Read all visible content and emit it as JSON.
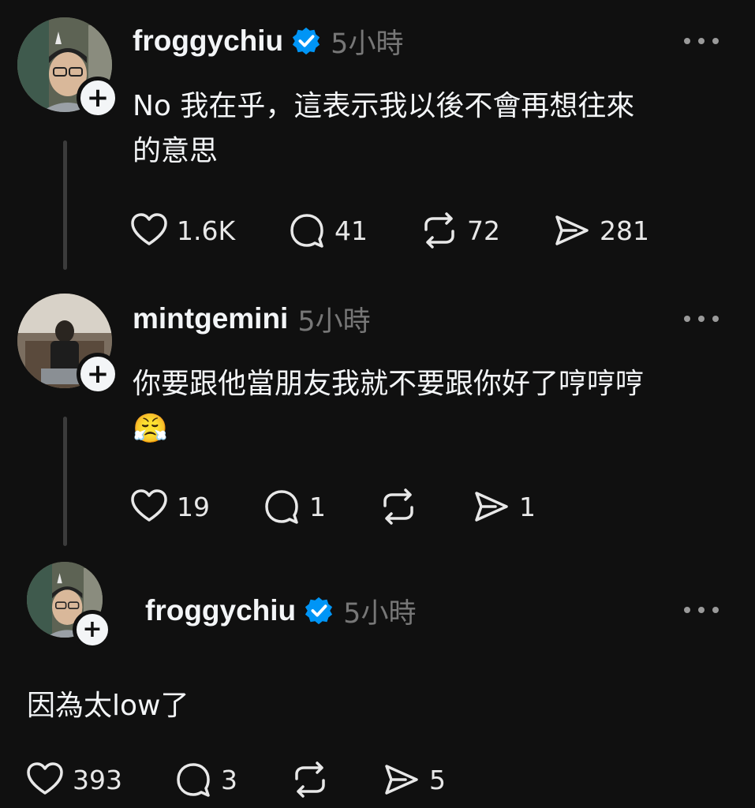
{
  "posts": [
    {
      "username": "froggychiu",
      "verified": true,
      "time": "5小時",
      "text": "No 我在乎，這表示我以後不會再想往來\n的意思",
      "likes": "1.6K",
      "replies": "41",
      "reposts": "72",
      "shares": "281"
    },
    {
      "username": "mintgemini",
      "verified": false,
      "time": "5小時",
      "text": "你要跟他當朋友我就不要跟你好了哼哼哼",
      "emoji": "😤",
      "likes": "19",
      "replies": "1",
      "reposts": "",
      "shares": "1"
    },
    {
      "username": "froggychiu",
      "verified": true,
      "time": "5小時",
      "text": "因為太low了",
      "likes": "393",
      "replies": "3",
      "reposts": "",
      "shares": "5"
    }
  ],
  "colors": {
    "background": "#101010",
    "verified_blue": "#0095f6",
    "thread_line": "#3b3b3b"
  },
  "icons": [
    "heart-icon",
    "comment-icon",
    "repost-icon",
    "share-icon",
    "more-icon",
    "verified-icon",
    "follow-plus-icon"
  ]
}
